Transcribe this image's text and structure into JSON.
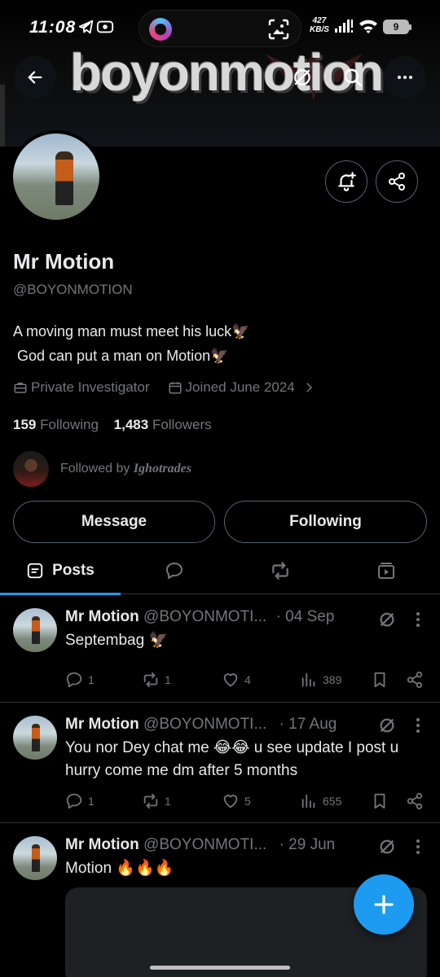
{
  "status_bar": {
    "time": "11:08",
    "net_speed_top": "427",
    "net_speed_bottom": "KB/S",
    "battery": "9"
  },
  "banner": {
    "text": "boyonmotion"
  },
  "profile": {
    "display_name": "Mr Motion",
    "handle": "@BOYONMOTION",
    "bio": "A moving man must meet his luck🦅\n God can put a man on Motion🦅",
    "occupation": "Private Investigator",
    "joined": "Joined June 2024",
    "following_count": "159",
    "following_label": "Following",
    "followers_count": "1,483",
    "followers_label": "Followers",
    "followed_by_prefix": "Followed by",
    "followed_by_name": "Ighotrades"
  },
  "buttons": {
    "message": "Message",
    "following": "Following"
  },
  "tabs": {
    "posts": "Posts"
  },
  "posts": [
    {
      "name": "Mr Motion",
      "handle": "@BOYONMOTI...",
      "date": "· 04 Sep",
      "text": "Septembag 🦅",
      "replies": "1",
      "reposts": "1",
      "likes": "4",
      "views": "389"
    },
    {
      "name": "Mr Motion",
      "handle": "@BOYONMOTI...",
      "date": "· 17 Aug",
      "text": "You nor Dey chat me 😂😂 u see update I post u hurry come me dm after 5 months",
      "replies": "1",
      "reposts": "1",
      "likes": "5",
      "views": "655"
    },
    {
      "name": "Mr Motion",
      "handle": "@BOYONMOTI...",
      "date": "· 29 Jun",
      "text": "Motion 🔥🔥🔥"
    }
  ],
  "colors": {
    "accent": "#1d9bf0",
    "text": "#e7e9ea",
    "muted": "#71767b",
    "border": "#2f3336"
  }
}
